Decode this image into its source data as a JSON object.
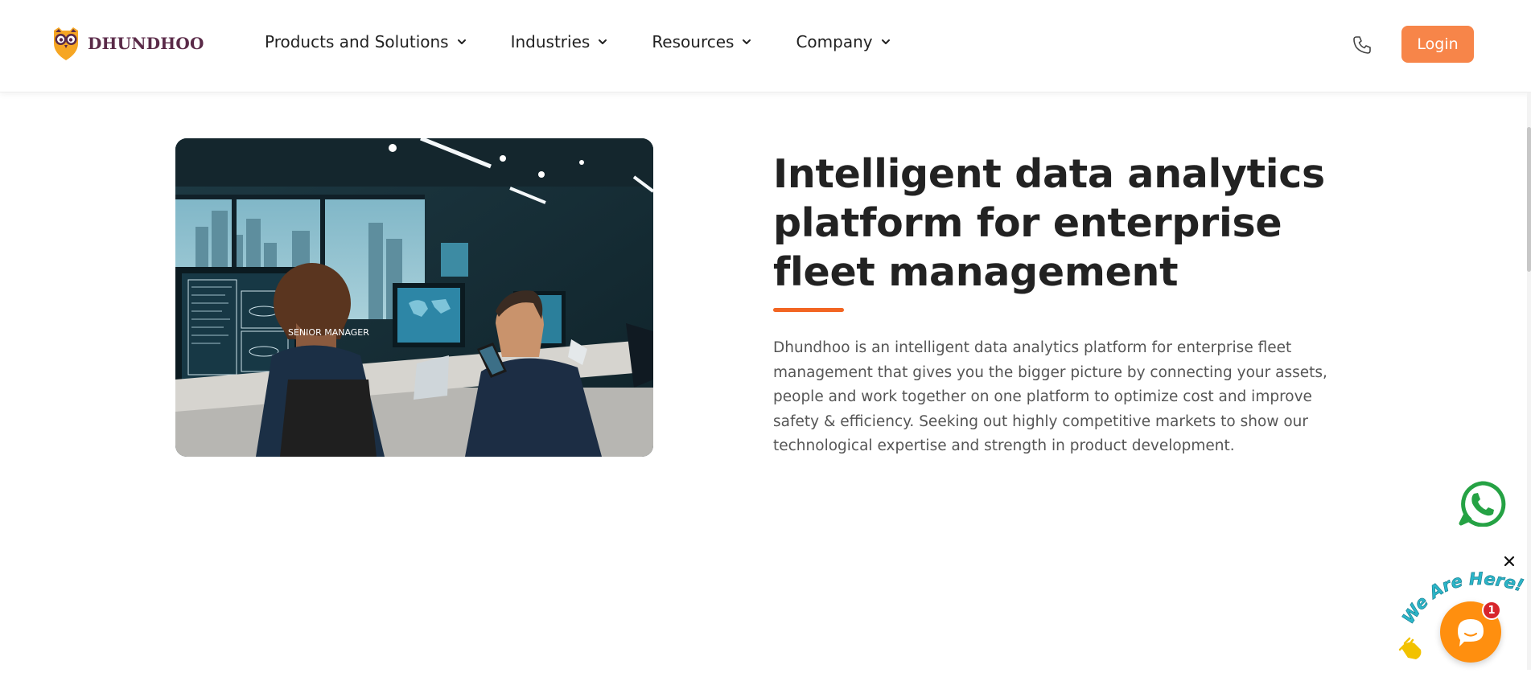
{
  "header": {
    "brand": "DHUNDHOO",
    "nav": [
      {
        "label": "Products and Solutions"
      },
      {
        "label": "Industries"
      },
      {
        "label": "Resources"
      },
      {
        "label": "Company"
      }
    ],
    "login_label": "Login",
    "phone_icon": "phone-icon"
  },
  "hero": {
    "image_text": "SENIOR MANAGER",
    "title": "Intelligent data analytics platform for enterprise fleet management",
    "description": "Dhundhoo is an intelligent data analytics platform for enterprise fleet management that gives you the bigger picture by connecting your assets, people and work together on one platform to optimize cost and improve safety & efficiency. Seeking out highly competitive markets to show our technological expertise and strength in product development."
  },
  "widgets": {
    "whatsapp_icon": "whatsapp-icon",
    "chat_banner": "We Are Here!",
    "chat_badge": "1",
    "close_icon": "close-icon"
  },
  "colors": {
    "brand": "#5a2a48",
    "login_bg": "#f78549",
    "accent": "#f26522",
    "whatsapp": "#25a244",
    "chat": "#ff8f0f",
    "chat_banner_text": "#2bb5c8"
  }
}
